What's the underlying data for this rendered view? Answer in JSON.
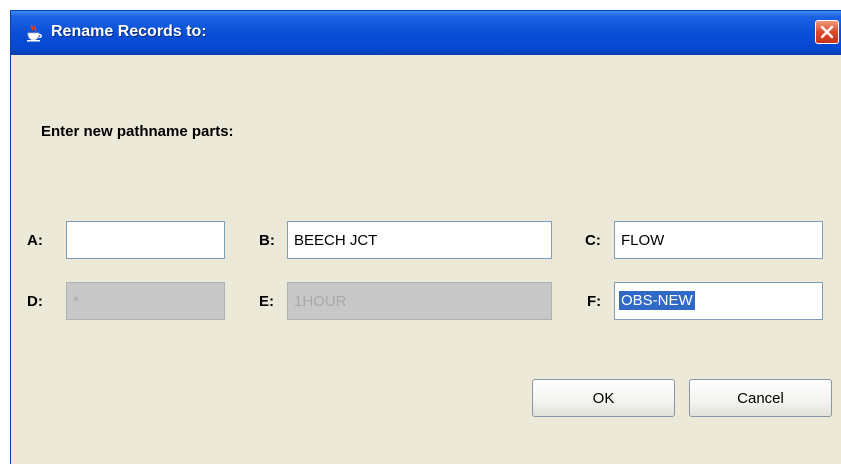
{
  "window": {
    "title": "Rename Records to:"
  },
  "heading": "Enter new pathname parts:",
  "fields": {
    "a": {
      "label": "A:",
      "value": ""
    },
    "b": {
      "label": "B:",
      "value": "BEECH JCT"
    },
    "c": {
      "label": "C:",
      "value": "FLOW"
    },
    "d": {
      "label": "D:",
      "value": "*"
    },
    "e": {
      "label": "E:",
      "value": "1HOUR"
    },
    "f": {
      "label": "F:",
      "value": "OBS-NEW"
    }
  },
  "buttons": {
    "ok": "OK",
    "cancel": "Cancel"
  },
  "icons": {
    "app": "java-cup-icon",
    "close": "close-icon"
  },
  "colors": {
    "titlebar": "#0a4fd8",
    "close": "#dc4a2a",
    "selection": "#3169c6",
    "background": "#ece9d8"
  }
}
